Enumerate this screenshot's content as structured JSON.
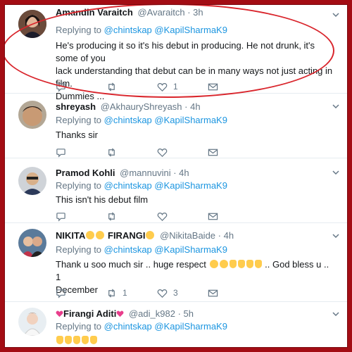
{
  "tweets": [
    {
      "name": "Amandin Varaitch",
      "handle": "@Avaraitch",
      "time": "· 3h",
      "replying_prefix": "Replying to",
      "mentions": [
        "@chintskap",
        "@KapilSharmaK9"
      ],
      "text_lines": [
        "He's producing it so it's his debut in producing. He not drunk, it's some of you",
        "lack understanding that debut can be in many ways not just acting in film.",
        "Dummies ..."
      ],
      "like_count": "1"
    },
    {
      "name": "shreyash",
      "handle": "@AkhauryShreyash",
      "time": "· 4h",
      "replying_prefix": "Replying to",
      "mentions": [
        "@chintskap",
        "@KapilSharmaK9"
      ],
      "text": "Thanks sir"
    },
    {
      "name": "Pramod Kohli",
      "handle": "@mannuvini",
      "time": "· 4h",
      "replying_prefix": "Replying to",
      "mentions": [
        "@chintskap",
        "@KapilSharmaK9"
      ],
      "text": "This isn't his debut film"
    },
    {
      "name_part1": "NIKITA",
      "name_part2": "FIRANGI",
      "handle": "@NikitaBaide",
      "time": "· 4h",
      "replying_prefix": "Replying to",
      "mentions": [
        "@chintskap",
        "@KapilSharmaK9"
      ],
      "text_before": "Thank u soo much sir .. huge respect",
      "text_after": ".. God bless u .. 1",
      "text_line2": "December",
      "retweet_count": "1",
      "like_count": "3"
    },
    {
      "name": "Firangi Aditi",
      "handle": "@adi_k982",
      "time": "· 5h",
      "replying_prefix": "Replying to",
      "mentions": [
        "@chintskap",
        "@KapilSharmaK9"
      ]
    }
  ],
  "colors": {
    "border_red": "#a30d14",
    "annotation_red": "#d9252c",
    "link_blue": "#1b95e0",
    "meta_gray": "#657786",
    "text_dark": "#14171a"
  },
  "icons": [
    "reply-icon",
    "retweet-icon",
    "like-icon",
    "chevron-down-icon",
    "emoji-icon",
    "clap-icon",
    "heart-icon"
  ]
}
